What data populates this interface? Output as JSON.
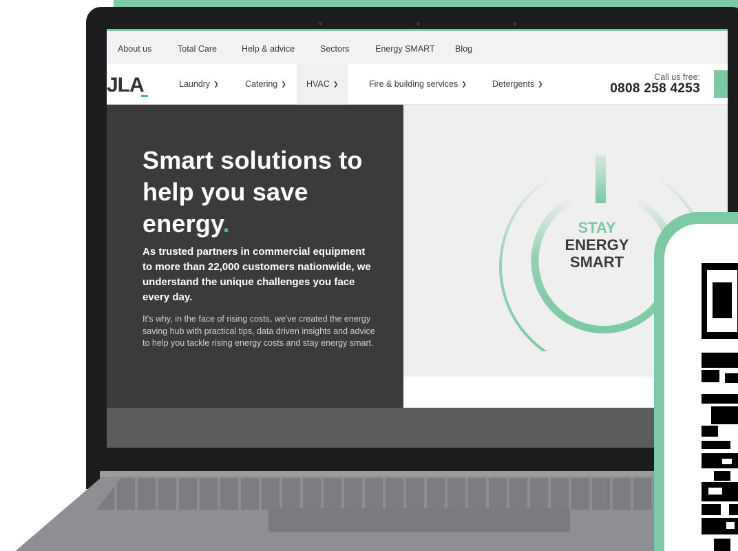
{
  "subnav": {
    "items": [
      "About us",
      "Total Care",
      "Help & advice",
      "Sectors",
      "Energy SMART",
      "Blog"
    ]
  },
  "mainnav": {
    "logo": "JLA",
    "items": [
      "Laundry",
      "Catering",
      "HVAC",
      "Fire & building services",
      "Detergents"
    ],
    "active_item": "HVAC",
    "call_label": "Call us free:",
    "phone": "0808 258 4253"
  },
  "hero": {
    "title": "Smart solutions to help you save energy",
    "title_accent": ".",
    "lead": "As trusted partners in commercial equipment to more than 22,000 customers nationwide, we understand the unique challenges you face every day.",
    "body": "It's why, in the face of rising costs, we've created the energy saving hub with practical tips, data driven insights and advice to help you tackle rising energy costs and stay energy smart."
  },
  "energy_badge": {
    "line1": "STAY",
    "line2": "ENERGY",
    "line3": "SMART"
  },
  "colors": {
    "accent_green": "#7cc9a3",
    "brand_green": "#4fb883",
    "dark_panel": "#3b3b3d"
  }
}
